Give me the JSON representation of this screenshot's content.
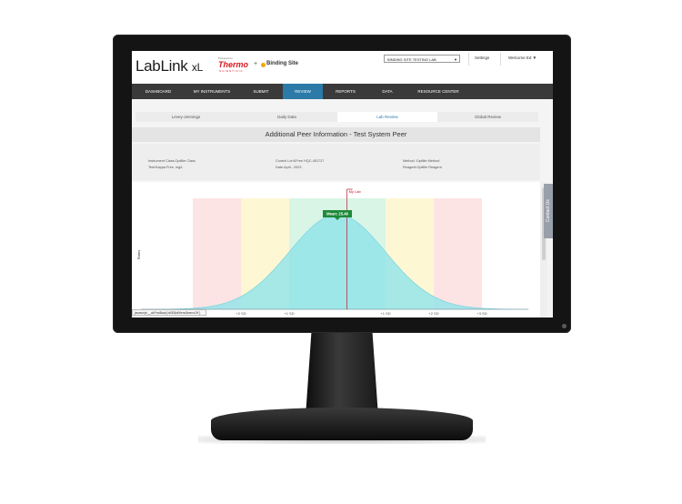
{
  "header": {
    "app_name": "LabLink",
    "app_suffix": "xL",
    "powered_by": "Powered by",
    "thermo": "Thermo",
    "scientific": "SCIENTIFIC",
    "plus": "+",
    "binding_site": "Binding Site",
    "lab_select": "BINDING SITE TESTING LAB",
    "settings": "Settings",
    "welcome": "Welcome Ed ▼"
  },
  "nav": [
    {
      "label": "DASHBOARD"
    },
    {
      "label": "MY INSTRUMENTS"
    },
    {
      "label": "SUBMIT"
    },
    {
      "label": "REVIEW",
      "active": true
    },
    {
      "label": "REPORTS"
    },
    {
      "label": "DATA"
    },
    {
      "label": "RESOURCE CENTER"
    }
  ],
  "tabs": [
    {
      "label": "Levey-Jennings"
    },
    {
      "label": "Daily Data"
    },
    {
      "label": "Lab Review",
      "active": true
    },
    {
      "label": "Global Review"
    }
  ],
  "panel_title": "Additional Peer Information - Test System Peer",
  "info": {
    "instrument_class": "Instrument Class:Optilite Class",
    "test": "Test:Kappa Free, mg/L",
    "control_lot": "Control Lot:KFree HQC-451727",
    "date": "Date:April - 2023",
    "method": "Method :Optilite Method",
    "reagent": "Reagent:Optilite Reagent"
  },
  "chart_data": {
    "type": "area",
    "distribution": "normal",
    "mean": 25.49,
    "mean_label": "Mean: 25.49",
    "my_lab_label": "My Lab",
    "my_lab_sd_offset": 0.05,
    "ylabel": "Rates",
    "x_ticks": [
      "+2 SD",
      "+1 SD",
      "+1 SD",
      "+2 SD",
      "+3 SD"
    ],
    "band_colors": [
      "#fde4e4",
      "#fdf7d4",
      "#d8f5e6",
      "#d8f5e6",
      "#fdf7d4",
      "#fde4e4"
    ],
    "curve_color": "#8fe3ea",
    "my_lab_color": "#c0142c",
    "mean_badge_color": "#1f8a3a"
  },
  "status_bar": "javascript:__doPostBack('ctl00$ctlMenu$menuOK')"
}
